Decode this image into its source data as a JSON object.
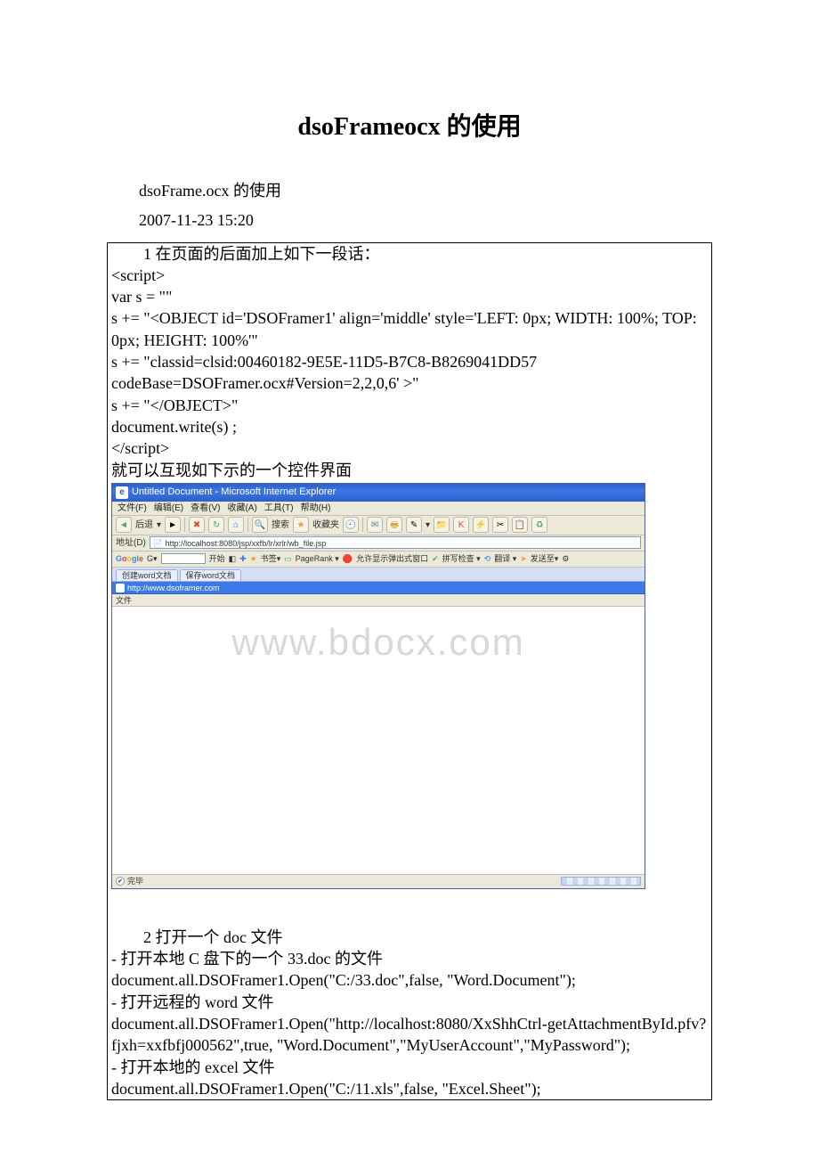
{
  "title": "dsoFrameocx 的使用",
  "intro": {
    "line1": "dsoFrame.ocx 的使用",
    "line2": "2007-11-23 15:20"
  },
  "section1": {
    "heading": "1 在页面的后面加上如下一段话：",
    "code": [
      "<script>",
      "var s = \"\"",
      "s += \"<OBJECT id='DSOFramer1' align='middle' style='LEFT: 0px; WIDTH: 100%; TOP: 0px; HEIGHT: 100%'\"",
      "s += \"classid=clsid:00460182-9E5E-11D5-B7C8-B8269041DD57 codeBase=DSOFramer.ocx#Version=2,2,0,6' >\"",
      "s += \"</OBJECT>\"",
      "document.write(s) ;",
      "</script>"
    ],
    "postline": "就可以互现如下示的一个控件界面"
  },
  "ie": {
    "title": "Untitled Document - Microsoft Internet Explorer",
    "menus": [
      "文件(F)",
      "编辑(E)",
      "查看(V)",
      "收藏(A)",
      "工具(T)",
      "帮助(H)"
    ],
    "toolbar": {
      "back": "后退",
      "search": "搜索",
      "favorites": "收藏夹"
    },
    "address_label": "地址(D)",
    "address_url": "http://localhost:8080/jsp/xxfb/lr/xrlr/wb_file.jsp",
    "google": {
      "label": "Google",
      "go": "开始",
      "bookmarks": "书签▾",
      "pagerank": "PageRank ▾",
      "popup": "允许显示弹出式窗口",
      "check": "拼写检查 ▾",
      "translate": "翻译 ▾",
      "sendto": "发送至▾"
    },
    "tabs": [
      "创建word文档",
      "保存word文档"
    ],
    "dso_url": "http://www.dsoframer.com",
    "dso_menu": "文件",
    "status": "完毕",
    "watermark": "www.bdocx.com"
  },
  "section2": {
    "heading": "2 打开一个 doc 文件",
    "lines": [
      "- 打开本地 C 盘下的一个 33.doc 的文件",
      "document.all.DSOFramer1.Open(\"C:/33.doc\",false, \"Word.Document\");",
      "- 打开远程的 word 文件",
      "document.all.DSOFramer1.Open(\"http://localhost:8080/XxShhCtrl-getAttachmentById.pfv?fjxh=xxfbfj000562\",true, \"Word.Document\",\"MyUserAccount\",\"MyPassword\");",
      "- 打开本地的 excel 文件",
      "document.all.DSOFramer1.Open(\"C:/11.xls\",false, \"Excel.Sheet\");"
    ]
  }
}
